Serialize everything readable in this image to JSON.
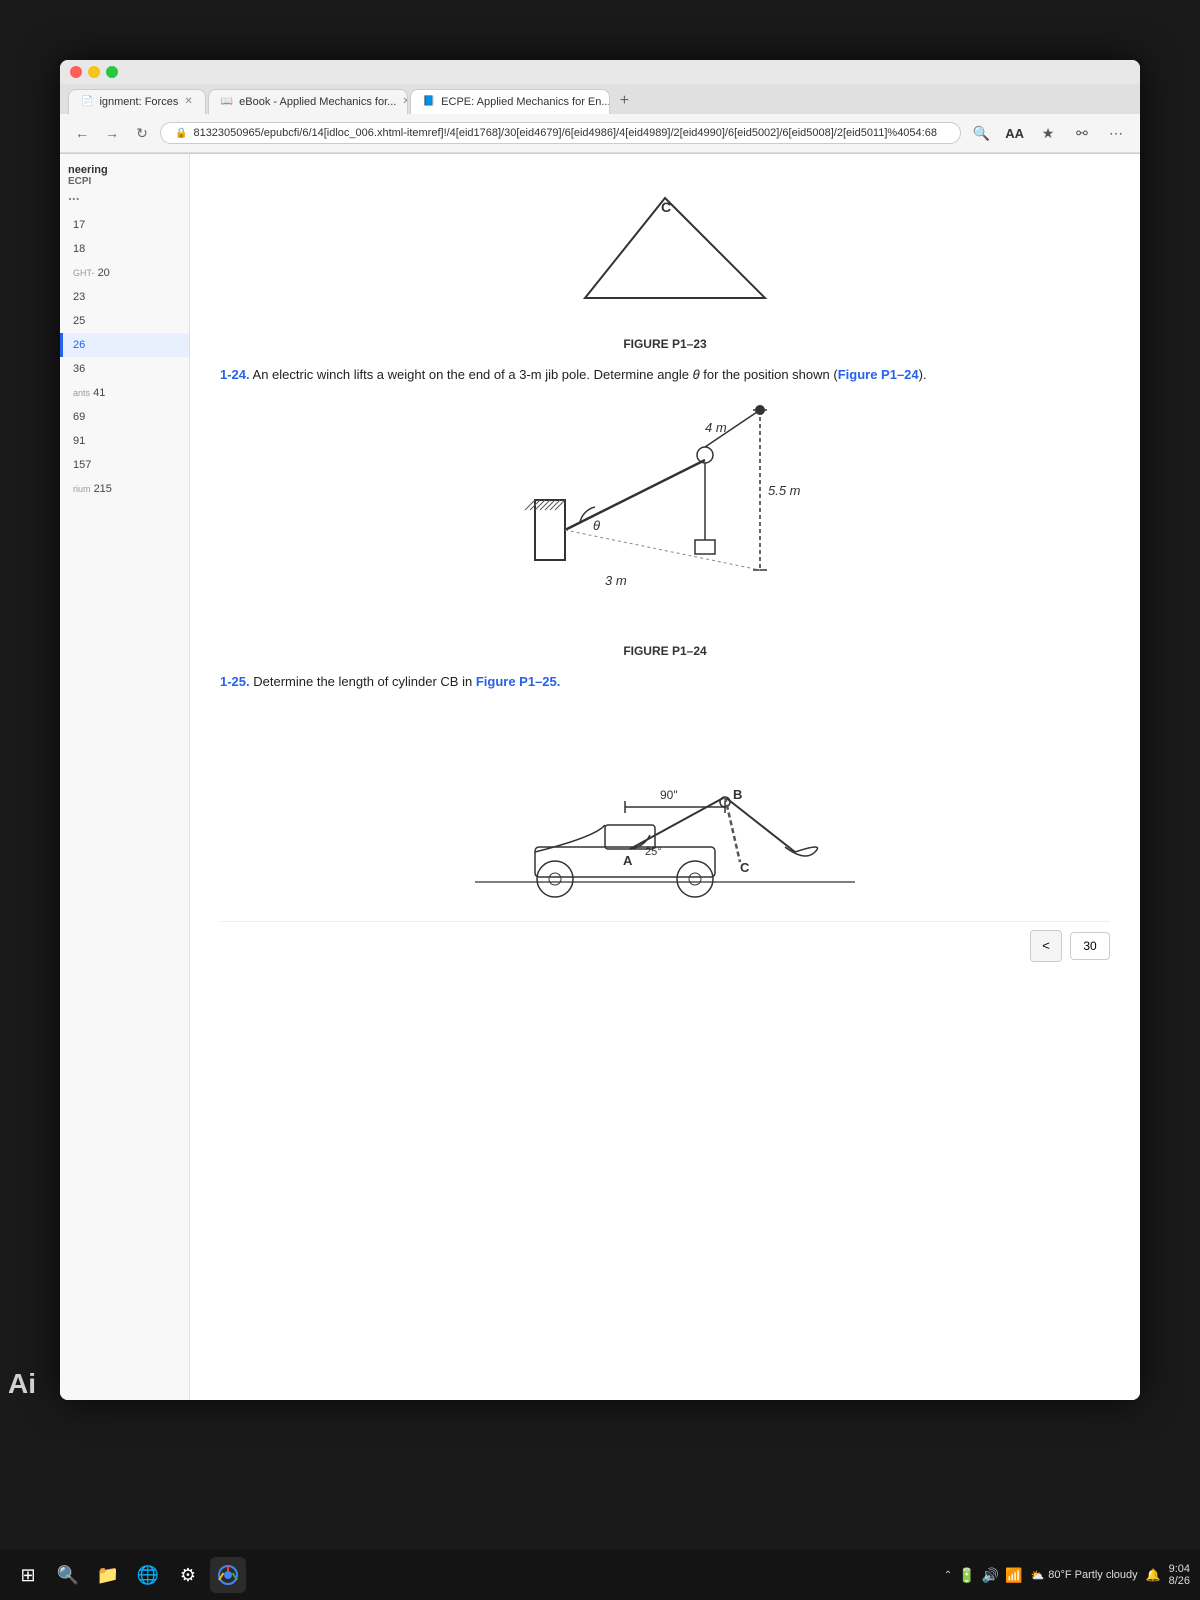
{
  "browser": {
    "tabs": [
      {
        "id": "tab1",
        "label": "ignment: Forces",
        "active": false,
        "favicon": "📄"
      },
      {
        "id": "tab2",
        "label": "eBook - Applied Mechanics for...",
        "active": false,
        "favicon": "📖"
      },
      {
        "id": "tab3",
        "label": "ECPE: Applied Mechanics for En...",
        "active": true,
        "favicon": "📘"
      }
    ],
    "address": "81323050965/epubcfi/6/14[idloc_006.xhtml-itemref]!/4[eid1768]/30[eid4679]/6[eid4986]/4[eid4989]/2[eid4990]/6[eid5002]/6[eid5008]/2[eid5011]%4054:68",
    "address_short": "81323050965/epubcfi/6/14[idloc_006.xhtml-itemref]!/4[eid1768]/30[eid4679]/6[eid4986]/4[eid4989]/2[eid4990]/6[eid5002]/6[eid5008]/2[eid5011]%4054:68",
    "new_tab_label": "+"
  },
  "sidebar": {
    "header": "neering",
    "sub_header": "ECPI",
    "more_icon": "...",
    "items": [
      {
        "number": "17",
        "active": false
      },
      {
        "number": "18",
        "active": false
      },
      {
        "number": "20",
        "label": "GHT-",
        "active": false
      },
      {
        "number": "23",
        "active": false
      },
      {
        "number": "25",
        "active": false
      },
      {
        "number": "26",
        "active": true
      },
      {
        "number": "36",
        "active": false
      },
      {
        "number": "41",
        "label": "ants",
        "active": false
      },
      {
        "number": "69",
        "active": false
      },
      {
        "number": "91",
        "active": false
      },
      {
        "number": "157",
        "active": false
      },
      {
        "number": "215",
        "label": "rium",
        "active": false
      }
    ]
  },
  "content": {
    "figure_p1_23_label": "FIGURE P1–23",
    "problem_1_24_number": "1-24.",
    "problem_1_24_text": "An electric winch lifts a weight on the end of a 3-m jib pole. Determine angle θ for the position shown (Figure P1–24).",
    "figure_p1_24_label": "FIGURE P1–24",
    "problem_1_25_number": "1-25.",
    "problem_1_25_text": "Determine the length of cylinder CB in Figure P1–25.",
    "figure_p1_25_ref": "Figure P1–25.",
    "figure_p1_24": {
      "dim_4m": "4 m",
      "dim_5_5m": "5.5 m",
      "dim_3m": "3 m",
      "angle_theta": "θ"
    },
    "figure_p1_25": {
      "dim_90": "90\"",
      "label_b": "B",
      "dim_25": "25°",
      "label_a": "A",
      "label_c": "C"
    }
  },
  "bottom_bar": {
    "page_number": "30",
    "prev_label": "<"
  },
  "taskbar": {
    "ai_label": "Ai",
    "weather": "80°F Partly cloudy",
    "time": "9:04",
    "date": "8/26",
    "icons": [
      {
        "name": "windows",
        "symbol": "⊞"
      },
      {
        "name": "search",
        "symbol": "🔍"
      },
      {
        "name": "file-explorer",
        "symbol": "📁"
      },
      {
        "name": "browser",
        "symbol": "🌐"
      },
      {
        "name": "settings",
        "symbol": "⚙"
      },
      {
        "name": "chrome",
        "symbol": "●"
      }
    ]
  },
  "colors": {
    "accent": "#2563eb",
    "active_sidebar": "#2563eb",
    "problem_number": "#2563eb"
  }
}
